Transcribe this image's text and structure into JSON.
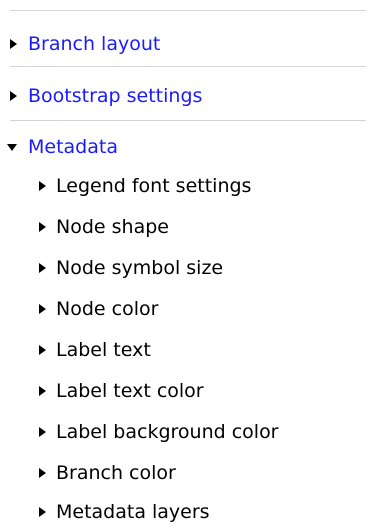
{
  "colors": {
    "link": "#1a1aff",
    "text": "#000000",
    "divider": "#d4d4d4"
  },
  "sections": [
    {
      "label": "Branch layout",
      "expanded": false,
      "arrow_icon": "triangle-right-icon"
    },
    {
      "label": "Bootstrap settings",
      "expanded": false,
      "arrow_icon": "triangle-right-icon"
    },
    {
      "label": "Metadata",
      "expanded": true,
      "arrow_icon": "triangle-down-icon"
    }
  ],
  "metadata_items": [
    {
      "label": "Legend font settings"
    },
    {
      "label": "Node shape"
    },
    {
      "label": "Node symbol size"
    },
    {
      "label": "Node color"
    },
    {
      "label": "Label text"
    },
    {
      "label": "Label text color"
    },
    {
      "label": "Label background color"
    },
    {
      "label": "Branch color"
    },
    {
      "label": "Metadata layers"
    }
  ]
}
